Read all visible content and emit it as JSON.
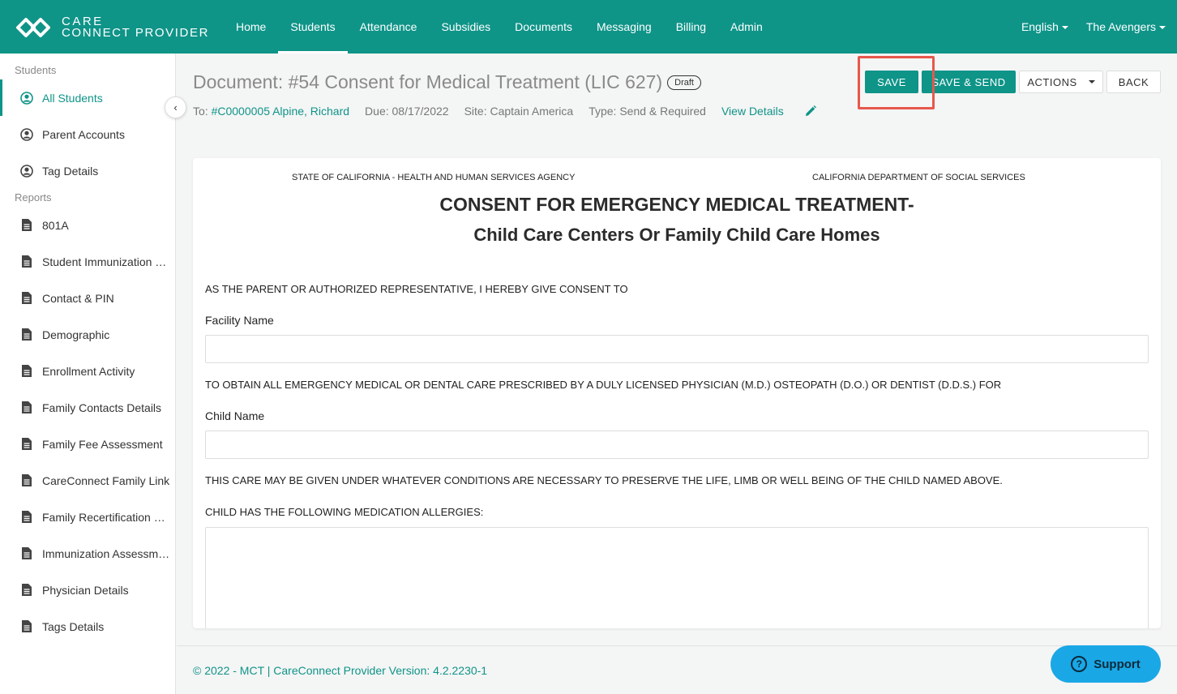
{
  "brand": {
    "line1": "CARE",
    "line2": "CONNECT PROVIDER"
  },
  "nav": {
    "items": [
      "Home",
      "Students",
      "Attendance",
      "Subsidies",
      "Documents",
      "Messaging",
      "Billing",
      "Admin"
    ],
    "active": "Students",
    "language": "English",
    "account": "The Avengers"
  },
  "sidebar": {
    "section1": "Students",
    "students": [
      {
        "label": "All Students",
        "icon": "user-circle-icon",
        "active": true
      },
      {
        "label": "Parent Accounts",
        "icon": "user-circle-icon"
      },
      {
        "label": "Tag Details",
        "icon": "user-circle-icon"
      }
    ],
    "section2": "Reports",
    "reports": [
      "801A",
      "Student Immunization Status",
      "Contact & PIN",
      "Demographic",
      "Enrollment Activity",
      "Family Contacts Details",
      "Family Fee Assessment",
      "CareConnect Family Link",
      "Family Recertification Report",
      "Immunization Assessment",
      "Physician Details",
      "Tags Details"
    ]
  },
  "header": {
    "title": "Document: #54 Consent for Medical Treatment (LIC 627)",
    "status": "Draft",
    "to_label": "To:",
    "to_value": "#C0000005 Alpine, Richard",
    "due": "Due: 08/17/2022",
    "site": "Site: Captain America",
    "type": "Type: Send & Required",
    "view_details": "View Details"
  },
  "buttons": {
    "save": "SAVE",
    "save_send": "SAVE & SEND",
    "actions": "ACTIONS",
    "back": "BACK"
  },
  "document": {
    "agency_left": "STATE OF CALIFORNIA - HEALTH AND HUMAN SERVICES AGENCY",
    "agency_right": "CALIFORNIA DEPARTMENT OF SOCIAL SERVICES",
    "title": "CONSENT FOR EMERGENCY MEDICAL TREATMENT-",
    "subtitle": "Child Care Centers Or Family Child Care Homes",
    "para1": "AS THE PARENT OR AUTHORIZED REPRESENTATIVE, I HEREBY GIVE CONSENT TO",
    "facility_label": "Facility Name",
    "facility_value": "",
    "para2": "TO OBTAIN ALL EMERGENCY MEDICAL OR DENTAL CARE PRESCRIBED BY A DULY LICENSED PHYSICIAN (M.D.) OSTEOPATH (D.O.) OR DENTIST (D.D.S.) FOR",
    "child_label": "Child Name",
    "child_value": "",
    "para3": "THIS CARE MAY BE GIVEN UNDER WHATEVER CONDITIONS ARE NECESSARY TO PRESERVE THE LIFE, LIMB OR WELL BEING OF THE CHILD NAMED ABOVE.",
    "allergies_label": "CHILD HAS THE FOLLOWING MEDICATION ALLERGIES:",
    "allergies_value": ""
  },
  "footer": {
    "text": "© 2022 - MCT | CareConnect Provider Version: 4.2.2230-1"
  },
  "support": {
    "label": "Support"
  },
  "colors": {
    "primary": "#0f9488",
    "highlight": "#e8574b",
    "support": "#1aa7e6"
  }
}
